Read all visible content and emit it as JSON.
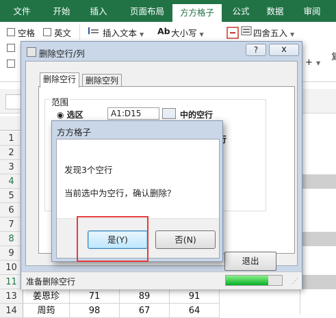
{
  "ribbon": {
    "tabs": [
      {
        "label": "文件",
        "active": false
      },
      {
        "label": "开始",
        "active": false
      },
      {
        "label": "插入",
        "active": false
      },
      {
        "label": "页面布局",
        "active": false
      },
      {
        "label": "方方格子",
        "active": true
      },
      {
        "label": "公式",
        "active": false
      },
      {
        "label": "数据",
        "active": false
      },
      {
        "label": "审阅",
        "active": false
      }
    ],
    "checkbox_space": "空格",
    "checkbox_english": "英文",
    "insert_text": "插入文本",
    "case": "大小写",
    "round": "四舍五入",
    "cut_label": "复"
  },
  "grid": {
    "row_numbers": [
      "1",
      "2",
      "3",
      "4",
      "5",
      "6",
      "7",
      "8",
      "9",
      "10",
      "11",
      "12",
      "13",
      "14"
    ],
    "rows": [
      {
        "name": "姜恩珍",
        "v1": "71",
        "v2": "89",
        "v3": "91"
      },
      {
        "name": "周筠",
        "v1": "98",
        "v2": "67",
        "v3": "64"
      }
    ]
  },
  "dialog": {
    "title": "删除空行/列",
    "help": "?",
    "close": "x",
    "tabs": [
      "删除空行",
      "删除空列"
    ],
    "group_label": "范围",
    "behind_option": "选区",
    "behind_range": "A1:D15",
    "behind_whole": "中的空行",
    "behind_second": "空行",
    "exit_button": "退出",
    "status": "准备删除空行",
    "progress": 0.75
  },
  "message_box": {
    "title": "方方格子",
    "line1": "发现3个空行",
    "line2": "当前选中为空行，确认删除？",
    "yes_button": "是(Y)",
    "no_button": "否(N)"
  },
  "colors": {
    "excel_green": "#217346",
    "highlight_red": "#e23b3b",
    "progress_green": "#06b025"
  }
}
